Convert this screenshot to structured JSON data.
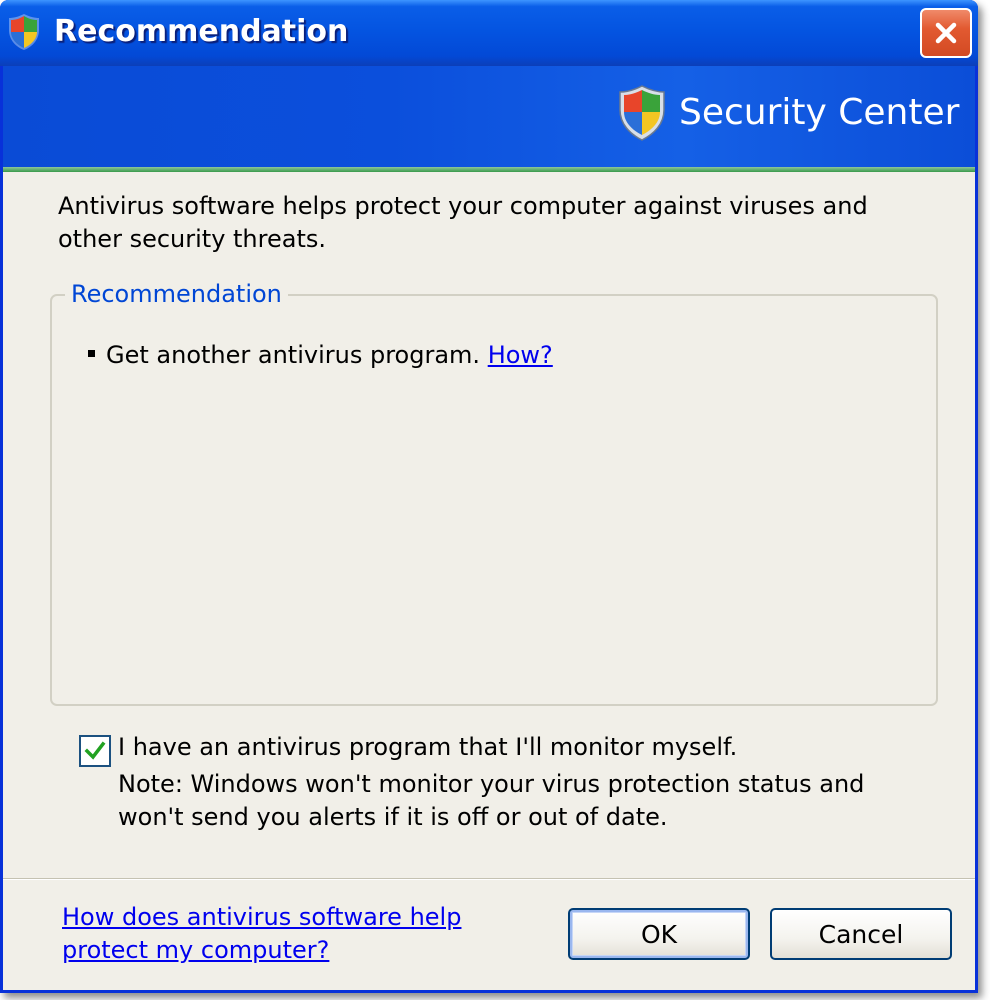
{
  "window": {
    "title": "Recommendation",
    "title_icon": "shield-icon",
    "close_icon": "close-icon"
  },
  "banner": {
    "icon": "security-shield-icon",
    "title": "Security Center"
  },
  "intro": "Antivirus software helps protect your computer against viruses and other security threats.",
  "recommendation_group": {
    "legend": "Recommendation",
    "items": [
      {
        "text": "Get another antivirus program.",
        "link": "How?"
      }
    ]
  },
  "monitor_option": {
    "checked": true,
    "label": "I have an antivirus program that I'll monitor myself.",
    "note": "Note: Windows won't monitor your virus protection status and won't send you alerts if it is off or out of date."
  },
  "footer": {
    "help_link": "How does antivirus software help protect my computer?",
    "ok_label": "OK",
    "cancel_label": "Cancel"
  },
  "colors": {
    "title_bar": "#0453e0",
    "banner": "#0b4fdc",
    "client_bg": "#f1efe8",
    "legend_text": "#0046d5",
    "link": "#0000ee",
    "checkmark": "#21a121",
    "close_button": "#e25a31"
  }
}
